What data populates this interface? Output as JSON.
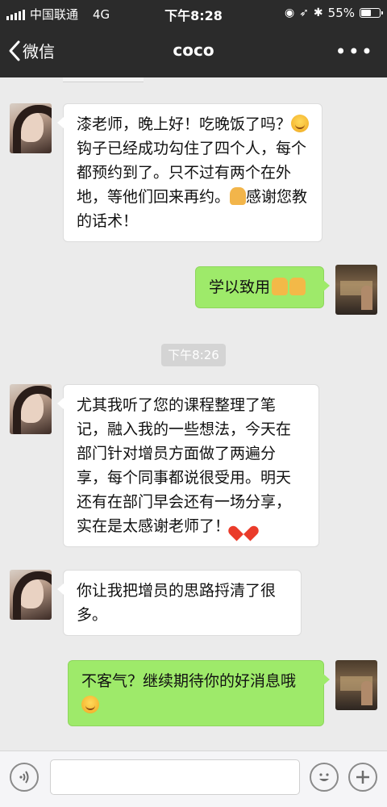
{
  "status_bar": {
    "carrier": "中国联通",
    "network": "4G",
    "time": "下午8:28",
    "battery_percent": "55%",
    "battery_level": 0.55
  },
  "nav": {
    "back_label": "微信",
    "title": "coco",
    "more_icon": "more-dots-icon"
  },
  "messages": [
    {
      "side": "left",
      "text_html": "漆老师，晚上好！吃晚饭了吗？<span class=\"emoji emoji-smile\" data-name=\"smile-emoji-icon\" data-interactable=\"false\"></span>钩子已经成功勾住了四个人，每个都预约到了。只不过有两个在外地，等他们回来再约。<span class=\"emoji emoji-pray\" data-name=\"pray-emoji-icon\" data-interactable=\"false\"></span>感谢您教的话术！",
      "text": "漆老师，晚上好！吃晚饭了吗？钩子已经成功勾住了四个人，每个都预约到了。只不过有两个在外地，等他们回来再约。感谢您教的话术！"
    },
    {
      "side": "right",
      "text": "学以致用"
    },
    {
      "side": "left",
      "text": "尤其我听了您的课程整理了笔记，融入我的一些想法，今天在部门针对增员方面做了两遍分享，每个同事都说很受用。明天还有在部门早会还有一场分享，实在是太感谢老师了！"
    },
    {
      "side": "left",
      "text": "你让我把增员的思路捋清了很多。"
    },
    {
      "side": "right",
      "text": "不客气？继续期待你的好消息哦"
    }
  ],
  "time_separator": "下午8:26",
  "input_bar": {
    "voice_icon": "voice-icon",
    "emoji_icon": "emoji-icon",
    "plus_icon": "plus-icon"
  }
}
